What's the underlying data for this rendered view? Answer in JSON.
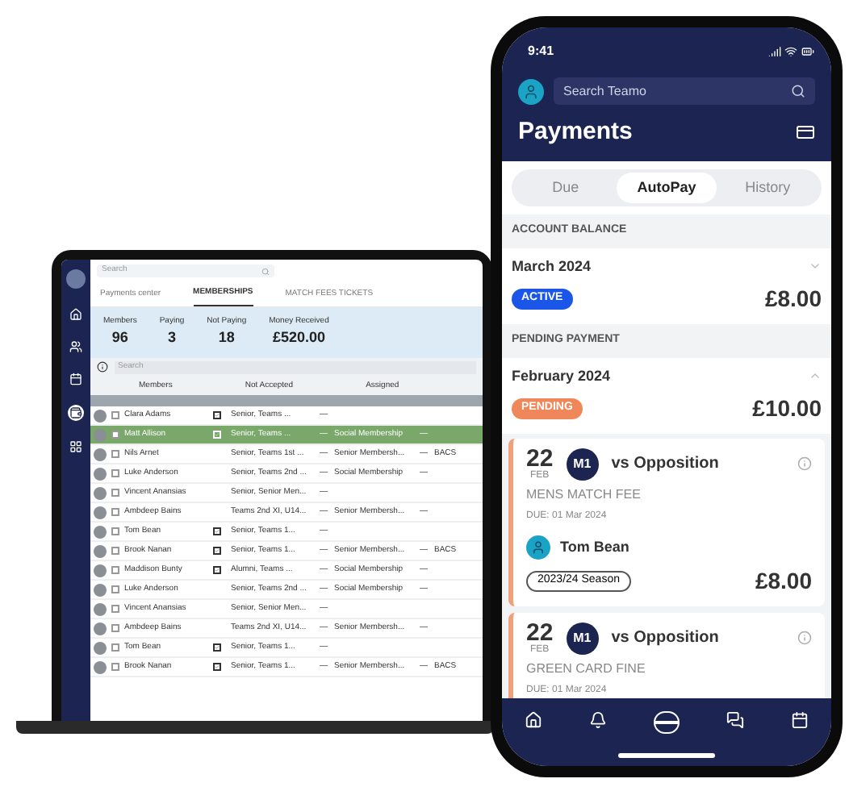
{
  "laptop": {
    "search": {
      "placeholder": "Search"
    },
    "tabs": [
      {
        "label": "Payments center",
        "selected": false
      },
      {
        "label": "MEMBERSHIPS",
        "selected": true
      },
      {
        "label": "MATCH FEES TICKETS",
        "selected": false
      }
    ],
    "stats": [
      {
        "label": "Members",
        "value": "96"
      },
      {
        "label": "Paying",
        "value": "3"
      },
      {
        "label": "Not Paying",
        "value": "18"
      },
      {
        "label": "Money Received",
        "value": "£520.00"
      }
    ],
    "table_search": {
      "placeholder": "Search"
    },
    "column_groups": [
      "Members",
      "Not Accepted",
      "Assigned"
    ],
    "rows": [
      {
        "name": "Clara Adams",
        "verified": true,
        "teams": "Senior, Teams ...",
        "col_3": "—",
        "selected": false
      },
      {
        "name": "Matt Allison",
        "verified": true,
        "teams": "Senior, Teams ...",
        "col_3": "—",
        "membership": "Social Membership",
        "col_5": "—",
        "selected": true
      },
      {
        "name": "Nils Arnet",
        "verified": false,
        "teams": "Senior, Teams 1st ...",
        "col_3": "—",
        "membership": "Senior Membersh...",
        "col_5": "—",
        "payment": "BACS",
        "selected": false
      },
      {
        "name": "Luke Anderson",
        "verified": false,
        "teams": "Senior, Teams 2nd ...",
        "col_3": "—",
        "membership": "Social Membership",
        "col_5": "—",
        "selected": false
      },
      {
        "name": "Vincent Anansias",
        "verified": false,
        "teams": "Senior, Senior Men...",
        "col_3": "—",
        "selected": false
      },
      {
        "name": "Ambdeep Bains",
        "verified": false,
        "teams": "Teams 2nd XI, U14...",
        "col_3": "—",
        "membership": "Senior Membersh...",
        "col_5": "—",
        "selected": false
      },
      {
        "name": "Tom Bean",
        "verified": true,
        "teams": "Senior, Teams 1...",
        "col_3": "—",
        "selected": false
      },
      {
        "name": "Brook Nanan",
        "verified": true,
        "teams": "Senior, Teams 1...",
        "col_3": "—",
        "membership": "Senior Membersh...",
        "col_5": "—",
        "payment": "BACS",
        "selected": false
      },
      {
        "name": "Maddison Bunty",
        "verified": true,
        "teams": "Alumni, Teams ...",
        "col_3": "—",
        "membership": "Social Membership",
        "col_5": "—",
        "selected": false
      },
      {
        "name": "Luke Anderson",
        "verified": false,
        "teams": "Senior, Teams 2nd ...",
        "col_3": "—",
        "membership": "Social Membership",
        "col_5": "—",
        "selected": false
      },
      {
        "name": "Vincent Anansias",
        "verified": false,
        "teams": "Senior, Senior Men...",
        "col_3": "—",
        "selected": false
      },
      {
        "name": "Ambdeep Bains",
        "verified": false,
        "teams": "Teams 2nd XI, U14...",
        "col_3": "—",
        "membership": "Senior Membersh...",
        "col_5": "—",
        "selected": false
      },
      {
        "name": "Tom Bean",
        "verified": true,
        "teams": "Senior, Teams 1...",
        "col_3": "—",
        "selected": false
      },
      {
        "name": "Brook Nanan",
        "verified": true,
        "teams": "Senior, Teams 1...",
        "col_3": "—",
        "membership": "Senior Membersh...",
        "col_5": "—",
        "payment": "BACS",
        "selected": false
      }
    ]
  },
  "phone": {
    "time": "9:41",
    "search": {
      "placeholder": "Search Teamo"
    },
    "title": "Payments",
    "tabs": [
      {
        "label": "Due",
        "selected": false
      },
      {
        "label": "AutoPay",
        "selected": true
      },
      {
        "label": "History",
        "selected": false
      }
    ],
    "sections": [
      {
        "heading": "ACCOUNT BALANCE",
        "month": "March 2024",
        "expanded": false,
        "badge": {
          "label": "ACTIVE",
          "color": "#1a56e8"
        },
        "amount": "£8.00"
      },
      {
        "heading": "PENDING PAYMENT",
        "month": "February 2024",
        "expanded": true,
        "badge": {
          "label": "PENDING",
          "color": "#f0875a"
        },
        "amount": "£10.00"
      }
    ],
    "fixtures": [
      {
        "day": "22",
        "month": "FEB",
        "team": "M1",
        "opponent": "vs Opposition",
        "fee": "MENS MATCH FEE",
        "due": "DUE: 01 Mar 2024",
        "member": "Tom Bean",
        "season": "2023/24 Season",
        "amount": "£8.00"
      },
      {
        "day": "22",
        "month": "FEB",
        "team": "M1",
        "opponent": "vs Opposition",
        "fee": "GREEN CARD FINE",
        "due": "DUE: 01 Mar 2024"
      }
    ]
  }
}
